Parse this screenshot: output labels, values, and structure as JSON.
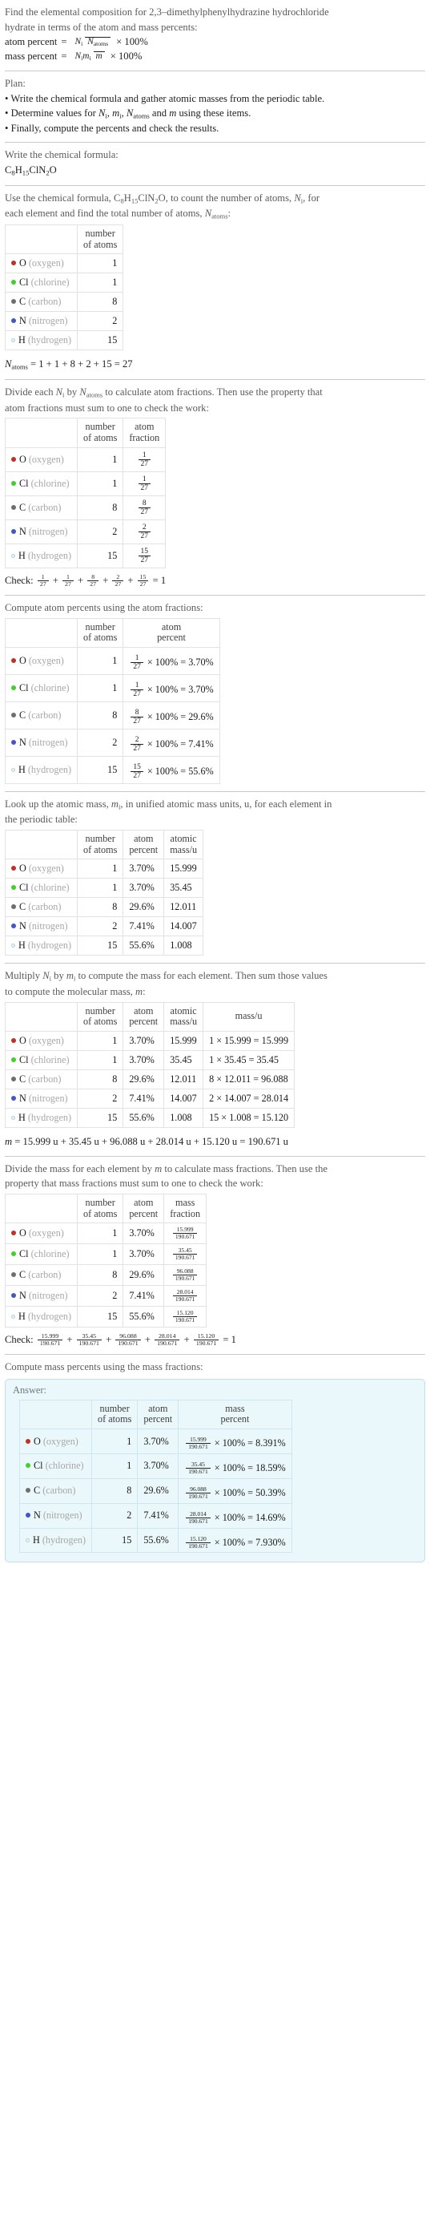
{
  "problem": {
    "title_line1": "Find the elemental composition for 2,3–dimethylphenylhydrazine hydrochloride",
    "title_line2": "hydrate in terms of the atom and mass percents:",
    "atom_percent_label": "atom percent",
    "mass_percent_label": "mass percent",
    "equals": "=",
    "times100": "× 100%",
    "atom_percent_num": "N",
    "atom_percent_num_sub": "i",
    "atom_percent_den": "N",
    "atom_percent_den_sub": "atoms",
    "mass_percent_num": "N",
    "mass_percent_num_sub": "i",
    "mass_percent_num2": "m",
    "mass_percent_num2_sub": "i",
    "mass_percent_den": "m"
  },
  "plan": {
    "heading": "Plan:",
    "bullets": [
      "• Write the chemical formula and gather atomic masses from the periodic table.",
      "• Determine values for Nᵢ, mᵢ, Nₐₜₒₘₛ and m using these items.",
      "• Finally, compute the percents and check the results."
    ],
    "bullet1": "Write the chemical formula and gather atomic masses from the periodic table.",
    "bullet2_pre": "Determine values for ",
    "bullet2_post": " using these items.",
    "bullet2_and": " and ",
    "bullet3": "Finally, compute the percents and check the results."
  },
  "formula_section": {
    "lead": "Write the chemical formula:",
    "formula_parts": [
      {
        "sym": "C",
        "sub": "8"
      },
      {
        "sym": "H",
        "sub": "15"
      },
      {
        "sym": "Cl",
        "sub": ""
      },
      {
        "sym": "N",
        "sub": "2"
      },
      {
        "sym": "O",
        "sub": ""
      }
    ],
    "formula_plain": "C8H15ClN2O"
  },
  "elements": [
    {
      "symbol": "O",
      "name": "(oxygen)",
      "color": "#c03028",
      "hollow": false,
      "count": "1",
      "fraction_num": "1",
      "fraction_den": "27",
      "atom_percent": "3.70%",
      "atomic_mass": "15.999",
      "mass_expr": "1 × 15.999 = 15.999",
      "mass_num": "15.999",
      "mass_den": "190.671",
      "mass_percent": "8.391%"
    },
    {
      "symbol": "Cl",
      "name": "(chlorine)",
      "color": "#3fd12a",
      "hollow": false,
      "count": "1",
      "fraction_num": "1",
      "fraction_den": "27",
      "atom_percent": "3.70%",
      "atomic_mass": "35.45",
      "mass_expr": "1 × 35.45 = 35.45",
      "mass_num": "35.45",
      "mass_den": "190.671",
      "mass_percent": "18.59%"
    },
    {
      "symbol": "C",
      "name": "(carbon)",
      "color": "#6e6e6e",
      "hollow": false,
      "count": "8",
      "fraction_num": "8",
      "fraction_den": "27",
      "atom_percent": "29.6%",
      "atomic_mass": "12.011",
      "mass_expr": "8 × 12.011 = 96.088",
      "mass_num": "96.088",
      "mass_den": "190.671",
      "mass_percent": "50.39%"
    },
    {
      "symbol": "N",
      "name": "(nitrogen)",
      "color": "#4455c8",
      "hollow": false,
      "count": "2",
      "fraction_num": "2",
      "fraction_den": "27",
      "atom_percent": "7.41%",
      "atomic_mass": "14.007",
      "mass_expr": "2 × 14.007 = 28.014",
      "mass_num": "28.014",
      "mass_den": "190.671",
      "mass_percent": "14.69%"
    },
    {
      "symbol": "H",
      "name": "(hydrogen)",
      "color": "#e8f4f8",
      "hollow": true,
      "count": "15",
      "fraction_num": "15",
      "fraction_den": "27",
      "atom_percent": "55.6%",
      "atomic_mass": "1.008",
      "mass_expr": "15 × 1.008 = 15.120",
      "mass_num": "15.120",
      "mass_den": "190.671",
      "mass_percent": "7.930%"
    }
  ],
  "headers": {
    "number_of_atoms_l1": "number",
    "number_of_atoms_l2": "of atoms",
    "atom_fraction_l1": "atom",
    "atom_fraction_l2": "fraction",
    "atom_percent_l1": "atom",
    "atom_percent_l2": "percent",
    "atomic_mass_l1": "atomic",
    "atomic_mass_l2": "mass/u",
    "mass_u_l1": "mass/u",
    "mass_fraction_l1": "mass",
    "mass_fraction_l2": "fraction",
    "mass_percent_l1": "mass",
    "mass_percent_l2": "percent"
  },
  "count_section": {
    "lead_pre": "Use the chemical formula, ",
    "lead_mid": ", to count the number of atoms, ",
    "lead_post": ", for",
    "lead_line2_pre": "each element and find the total number of atoms, ",
    "lead_line2_post": ":",
    "natoms_result": "= 1 + 1 + 8 + 2 + 15 = 27",
    "natoms_label": "N",
    "natoms_sub": "atoms"
  },
  "fraction_section": {
    "lead_line1_a": "Divide each ",
    "lead_line1_b": " by ",
    "lead_line1_c": " to calculate atom fractions. Then use the property that",
    "lead_line2": "atom fractions must sum to one to check the work:",
    "check_label": "Check:",
    "check_result": "= 1"
  },
  "atom_percent_section": {
    "lead": "Compute atom percents using the atom fractions:",
    "times100": "× 100% ="
  },
  "atomic_mass_section": {
    "lead_line1": "Look up the atomic mass, mᵢ, in unified atomic mass units, u, for each element in",
    "lead_line1_a": "Look up the atomic mass, ",
    "lead_line1_b": ", in unified atomic mass units, u, for each element in",
    "lead_line2": "the periodic table:"
  },
  "molecular_mass_section": {
    "lead_line1_a": "Multiply ",
    "lead_line1_b": " by ",
    "lead_line1_c": " to compute the mass for each element. Then sum those values",
    "lead_line2_a": "to compute the molecular mass, ",
    "lead_line2_b": ":",
    "mass_header": "mass/u",
    "total": "= 15.999 u + 35.45 u + 96.088 u + 28.014 u + 15.120 u = 190.671 u",
    "total_label": "m"
  },
  "mass_fraction_section": {
    "lead_line1": "Divide the mass for each element by m to calculate mass fractions. Then use the",
    "lead_line1_a": "Divide the mass for each element by ",
    "lead_line1_b": " to calculate mass fractions. Then use the",
    "lead_line2": "property that mass fractions must sum to one to check the work:",
    "check_label": "Check:",
    "check_result": "= 1"
  },
  "answer_section": {
    "lead": "Compute mass percents using the mass fractions:",
    "answer_label": "Answer:",
    "times100": "× 100% ="
  }
}
